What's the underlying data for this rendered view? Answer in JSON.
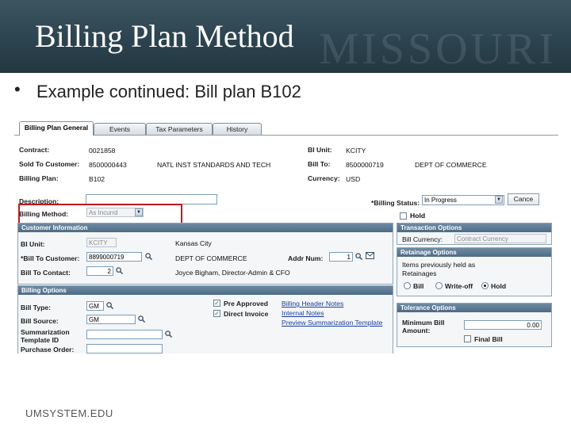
{
  "slide": {
    "title": "Billing Plan Method",
    "watermark": "MISSOURI",
    "bullet_marker": "•",
    "bullet": "Example continued: Bill plan B102",
    "footer": "UMSYSTEM.EDU"
  },
  "tabs": [
    {
      "label": "Billing Plan General",
      "active": true
    },
    {
      "label": "Events",
      "active": false
    },
    {
      "label": "Tax Parameters",
      "active": false
    },
    {
      "label": "History",
      "active": false
    }
  ],
  "header_fields": {
    "contract_label": "Contract:",
    "contract_value": "0021858",
    "sold_to_label": "Sold To Customer:",
    "sold_to_value": "8500000443",
    "sold_to_name": "NATL INST STANDARDS AND TECH",
    "billing_plan_label": "Billing Plan:",
    "billing_plan_value": "B102",
    "bi_unit_label": "BI Unit:",
    "bi_unit_value": "KCITY",
    "bill_to_label": "Bill To:",
    "bill_to_value": "8500000719",
    "bill_to_name": "DEPT OF COMMERCE",
    "currency_label": "Currency:",
    "currency_value": "USD"
  },
  "description": {
    "label": "Description:",
    "value": ""
  },
  "billing_method": {
    "label": "Billing Method:",
    "value": "As Incurrd"
  },
  "billing_status": {
    "label": "*Billing Status:",
    "value": "In Progress",
    "cancel_label": "Cance",
    "hold_label": "Hold"
  },
  "customer_info": {
    "header": "Customer Information",
    "bi_unit_label": "BI Unit:",
    "bi_unit_value": "KCITY",
    "bi_unit_desc": "Kansas City",
    "bill_to_customer_label": "*Bill To Customer:",
    "bill_to_customer_value": "8899000719",
    "bill_to_customer_name": "DEPT OF COMMERCE",
    "addr_num_label": "Addr Num:",
    "addr_num_value": "1",
    "bill_to_contact_label": "Bill To Contact:",
    "bill_to_contact_value": "2",
    "bill_to_contact_name": "Joyce Bigham, Director-Admin & CFO"
  },
  "transaction_options": {
    "header": "Transaction Options",
    "bill_currency_label": "Bill Currency:",
    "bill_currency_value": "Contract Currency"
  },
  "retainage_options": {
    "header": "Retainage Options",
    "items_label": "Items previously held as",
    "retainages_label": "Retainages",
    "radios": [
      {
        "label": "Bill",
        "checked": false
      },
      {
        "label": "Write-off",
        "checked": false
      },
      {
        "label": "Hold",
        "checked": true
      }
    ]
  },
  "billing_options": {
    "header": "Billing Options",
    "bill_type_label": "Bill Type:",
    "bill_type_value": "GM",
    "bill_source_label": "Bill Source:",
    "bill_source_value": "GM",
    "summarization_label_1": "Summarization",
    "summarization_label_2": "Template ID",
    "purchase_order_label": "Purchase Order:",
    "pre_approved_label": "Pre Approved",
    "direct_invoice_label": "Direct Invoice",
    "links": [
      "Billing Header Notes",
      "Internal Notes",
      "Preview Summarization Template"
    ]
  },
  "tolerance_options": {
    "header": "Tolerance Options",
    "min_bill_label_1": "Minimum Bill",
    "min_bill_label_2": "Amount:",
    "min_bill_value": "0.00",
    "final_bill_label": "Final Bill"
  },
  "colors": {
    "header_bg": "#2c4450",
    "highlight": "#c0181f",
    "panel_header": "#5a7690",
    "link": "#1a3d9c"
  }
}
